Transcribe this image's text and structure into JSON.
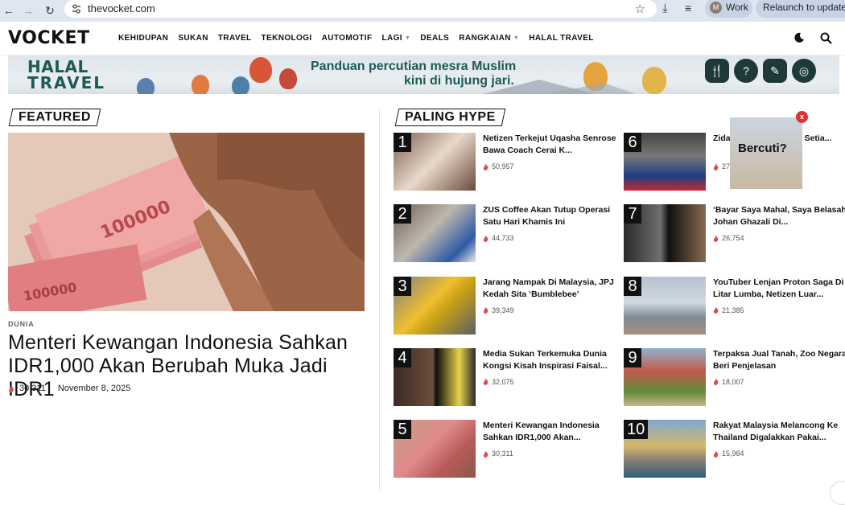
{
  "browser": {
    "url": "thevocket.com",
    "profile_initial": "M",
    "profile_name": "Work",
    "relaunch_label": "Relaunch to update"
  },
  "site": {
    "logo": "VOCKET",
    "menu": [
      {
        "label": "KEHIDUPAN",
        "dropdown": false
      },
      {
        "label": "SUKAN",
        "dropdown": false
      },
      {
        "label": "TRAVEL",
        "dropdown": false
      },
      {
        "label": "TEKNOLOGI",
        "dropdown": false
      },
      {
        "label": "AUTOMOTIF",
        "dropdown": false
      },
      {
        "label": "LAGI",
        "dropdown": true
      },
      {
        "label": "DEALS",
        "dropdown": false
      },
      {
        "label": "RANGKAIAN",
        "dropdown": true
      },
      {
        "label": "HALAL TRAVEL",
        "dropdown": false
      }
    ]
  },
  "banner": {
    "brand_line1": "HALAL",
    "brand_line2": "TRAVEL",
    "text_line1": "Panduan percutian mesra Muslim",
    "text_line2": "kini di hujung jari.",
    "icons": [
      "utensils-icon",
      "tips-icon",
      "activity-icon",
      "compass-icon"
    ]
  },
  "featured": {
    "section_label": "FEATURED",
    "category": "DUNIA",
    "title": "Menteri Kewangan Indonesia Sahkan IDR1,000 Akan Berubah Muka Jadi IDR1",
    "views": "30,311",
    "date": "November 8, 2025"
  },
  "hype": {
    "section_label": "PALING HYPE",
    "items": [
      {
        "rank": "1",
        "title": "Netizen Terkejut Uqasha Senrose Bawa Coach Cerai K...",
        "views": "50,957"
      },
      {
        "rank": "2",
        "title": "ZUS Coffee Akan Tutup Operasi Satu Hari Khamis Ini",
        "views": "44,733"
      },
      {
        "rank": "3",
        "title": "Jarang Nampak Di Malaysia, JPJ Kedah Sita ‘Bumblebee’",
        "views": "39,349"
      },
      {
        "rank": "4",
        "title": "Media Sukan Terkemuka Dunia Kongsi Kisah Inspirasi Faisal...",
        "views": "32,075"
      },
      {
        "rank": "5",
        "title": "Menteri Kewangan Indonesia Sahkan IDR1,000 Akan...",
        "views": "30,311"
      },
      {
        "rank": "6",
        "title": "Zidane Pemain Yang... Setia...",
        "views": "27"
      },
      {
        "rank": "7",
        "title": "‘Bayar Saya Mahal, Saya Belasah Johan Ghazali Di...",
        "views": "26,754"
      },
      {
        "rank": "8",
        "title": "YouTuber Lenjan Proton Saga Di Litar Lumba, Netizen Luar...",
        "views": "21,385"
      },
      {
        "rank": "9",
        "title": "Terpaksa Jual Tanah, Zoo Negara Beri Penjelasan",
        "views": "18,007"
      },
      {
        "rank": "10",
        "title": "Rakyat Malaysia Melancong Ke Thailand Digalakkan Pakai...",
        "views": "15,984"
      }
    ]
  },
  "popup": {
    "text": "Bercuti?",
    "close_label": "x"
  },
  "colors": {
    "accent": "#111111",
    "banner_teal": "#1e5a55",
    "flame": "#e5484d",
    "close": "#dd3333"
  }
}
